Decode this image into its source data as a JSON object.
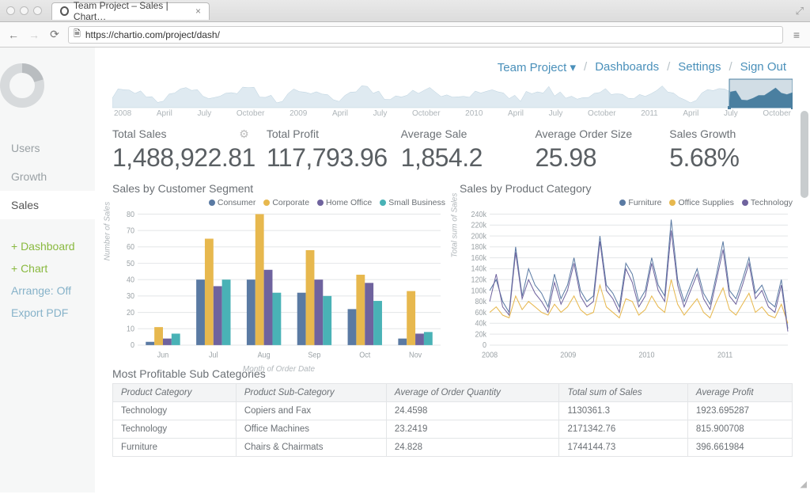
{
  "browser": {
    "tab_title": "Team Project – Sales | Chart…",
    "url": "https://chartio.com/project/dash/"
  },
  "sidebar": {
    "items": [
      {
        "label": "Users"
      },
      {
        "label": "Growth"
      },
      {
        "label": "Sales"
      }
    ],
    "actions": {
      "dashboard": "+ Dashboard",
      "chart": "+ Chart"
    },
    "subs": {
      "arrange": "Arrange: Off",
      "export": "Export PDF"
    }
  },
  "topnav": {
    "project": "Team Project ▾",
    "dashboards": "Dashboards",
    "settings": "Settings",
    "signout": "Sign Out"
  },
  "timeline_labels": [
    "2008",
    "April",
    "July",
    "October",
    "2009",
    "April",
    "July",
    "October",
    "2010",
    "April",
    "July",
    "October",
    "2011",
    "April",
    "July",
    "October"
  ],
  "kpis": [
    {
      "label": "Total Sales",
      "value": "1,488,922.81",
      "gear": true
    },
    {
      "label": "Total Profit",
      "value": "117,793.96"
    },
    {
      "label": "Average Sale",
      "value": "1,854.2"
    },
    {
      "label": "Average Order Size",
      "value": "25.98"
    },
    {
      "label": "Sales Growth",
      "value": "5.68%"
    }
  ],
  "bar_legend": [
    "Consumer",
    "Corporate",
    "Home Office",
    "Small Business"
  ],
  "bar_colors": [
    "#5a7aa3",
    "#e7b84e",
    "#6f639e",
    "#49b2b6"
  ],
  "line_legend": [
    "Furniture",
    "Office Supplies",
    "Technology"
  ],
  "line_colors": [
    "#5a7aa3",
    "#e7b84e",
    "#6f639e"
  ],
  "bar_title": "Sales by Customer Segment",
  "line_title": "Sales by Product Category",
  "bar_ylabel": "Number of Sales",
  "bar_xlabel": "Month of Order Date",
  "line_ylabel": "Total sum of Sales",
  "table_title": "Most Profitable Sub Categories",
  "table": {
    "columns": [
      "Product Category",
      "Product Sub-Category",
      "Average of Order Quantity",
      "Total sum of Sales",
      "Average Profit"
    ],
    "rows": [
      [
        "Technology",
        "Copiers and Fax",
        "24.4598",
        "1130361.3",
        "1923.695287"
      ],
      [
        "Technology",
        "Office Machines",
        "23.2419",
        "2171342.76",
        "815.900708"
      ],
      [
        "Furniture",
        "Chairs & Chairmats",
        "24.828",
        "1744144.73",
        "396.661984"
      ]
    ]
  },
  "chart_data": [
    {
      "type": "bar",
      "title": "Sales by Customer Segment",
      "xlabel": "Month of Order Date",
      "ylabel": "Number of Sales",
      "ylim": [
        0,
        80
      ],
      "yticks": [
        0,
        10,
        20,
        30,
        40,
        50,
        60,
        70,
        80
      ],
      "categories": [
        "Jun",
        "Jul",
        "Aug",
        "Sep",
        "Oct",
        "Nov"
      ],
      "series": [
        {
          "name": "Consumer",
          "color": "#5a7aa3",
          "values": [
            2,
            40,
            40,
            32,
            22,
            4
          ]
        },
        {
          "name": "Corporate",
          "color": "#e7b84e",
          "values": [
            11,
            65,
            80,
            58,
            43,
            33
          ]
        },
        {
          "name": "Home Office",
          "color": "#6f639e",
          "values": [
            4,
            36,
            46,
            40,
            38,
            7
          ]
        },
        {
          "name": "Small Business",
          "color": "#49b2b6",
          "values": [
            7,
            40,
            32,
            30,
            27,
            8
          ]
        }
      ]
    },
    {
      "type": "line",
      "title": "Sales by Product Category",
      "ylabel": "Total sum of Sales",
      "ylim": [
        0,
        240000
      ],
      "yticks": [
        0,
        20000,
        40000,
        60000,
        80000,
        100000,
        120000,
        140000,
        160000,
        180000,
        200000,
        220000,
        240000
      ],
      "ytick_labels": [
        "0",
        "20k",
        "40k",
        "60k",
        "80k",
        "100k",
        "120k",
        "140k",
        "160k",
        "180k",
        "200k",
        "220k",
        "240k"
      ],
      "xticks": [
        "2008",
        "2009",
        "2010",
        "2011"
      ],
      "series": [
        {
          "name": "Furniture",
          "color": "#5a7aa3",
          "values": [
            100,
            120,
            80,
            60,
            180,
            90,
            140,
            110,
            95,
            70,
            130,
            85,
            110,
            160,
            100,
            80,
            90,
            200,
            110,
            95,
            70,
            150,
            130,
            80,
            100,
            160,
            110,
            90,
            230,
            120,
            80,
            110,
            140,
            95,
            75,
            130,
            190,
            100,
            85,
            120,
            160,
            95,
            110,
            80,
            70,
            120,
            30
          ]
        },
        {
          "name": "Office Supplies",
          "color": "#e7b84e",
          "values": [
            60,
            70,
            55,
            50,
            90,
            65,
            80,
            70,
            60,
            55,
            75,
            60,
            70,
            90,
            65,
            55,
            60,
            110,
            70,
            60,
            50,
            85,
            80,
            55,
            65,
            90,
            70,
            60,
            120,
            75,
            55,
            70,
            85,
            60,
            50,
            80,
            105,
            65,
            55,
            75,
            95,
            60,
            70,
            55,
            50,
            75,
            40
          ]
        },
        {
          "name": "Technology",
          "color": "#6f639e",
          "values": [
            80,
            130,
            70,
            55,
            170,
            85,
            120,
            95,
            80,
            60,
            115,
            75,
            100,
            150,
            90,
            70,
            80,
            190,
            100,
            85,
            60,
            140,
            115,
            70,
            90,
            150,
            100,
            80,
            210,
            110,
            70,
            100,
            130,
            85,
            65,
            120,
            175,
            90,
            75,
            110,
            150,
            85,
            100,
            70,
            60,
            110,
            25
          ]
        }
      ]
    }
  ]
}
